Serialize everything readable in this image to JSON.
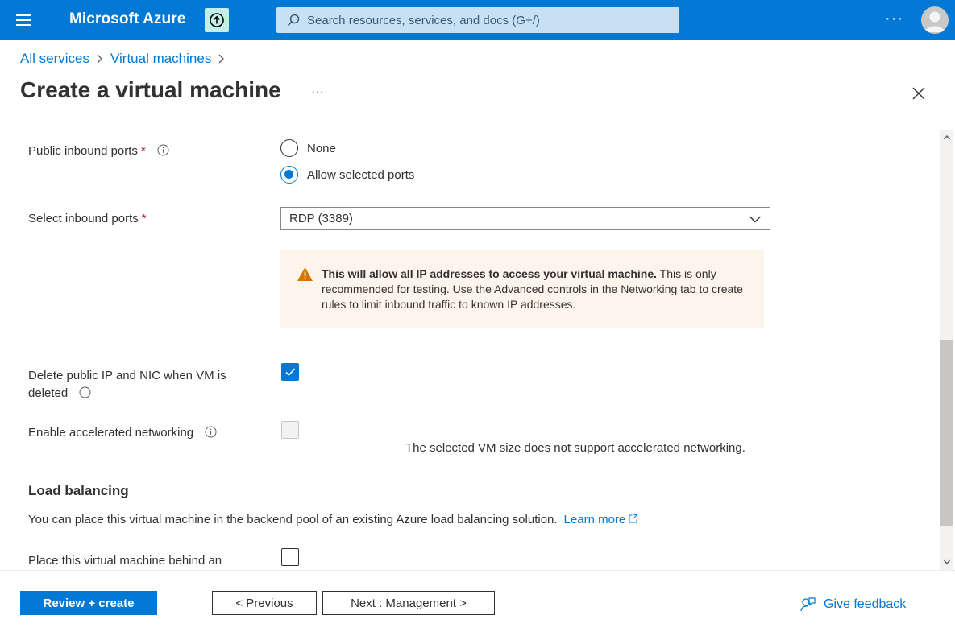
{
  "topbar": {
    "brand": "Microsoft Azure",
    "search_placeholder": "Search resources, services, and docs (G+/)",
    "more": "···",
    "color": "#0078d4"
  },
  "breadcrumb": {
    "items": [
      "All services",
      "Virtual machines"
    ]
  },
  "page": {
    "title": "Create a virtual machine",
    "more": "···"
  },
  "form": {
    "public_inbound_ports": {
      "label": "Public inbound ports",
      "required_mark": "*",
      "options": [
        "None",
        "Allow selected ports"
      ],
      "selected": "Allow selected ports"
    },
    "select_inbound_ports": {
      "label": "Select inbound ports",
      "required_mark": "*",
      "value": "RDP (3389)"
    },
    "warning": {
      "bold": "This will allow all IP addresses to access your virtual machine.",
      "text": " This is only recommended for testing.  Use the Advanced controls in the Networking tab to create rules to limit inbound traffic to known IP addresses."
    },
    "delete_public_ip": {
      "label_line1": "Delete public IP and NIC when VM is",
      "label_line2": "deleted",
      "checked": true
    },
    "accelerated_networking": {
      "label": "Enable accelerated networking",
      "checked": false,
      "disabled": true,
      "note": "The selected VM size does not support accelerated networking."
    },
    "load_balancing": {
      "title": "Load balancing",
      "description": "You can place this virtual machine in the backend pool of an existing Azure load balancing solution.",
      "learn_more": "Learn more",
      "place_behind_label": "Place this virtual machine behind an",
      "checked": false
    }
  },
  "footer": {
    "review_create": "Review + create",
    "previous": "< Previous",
    "next": "Next : Management >",
    "feedback": "Give feedback"
  }
}
